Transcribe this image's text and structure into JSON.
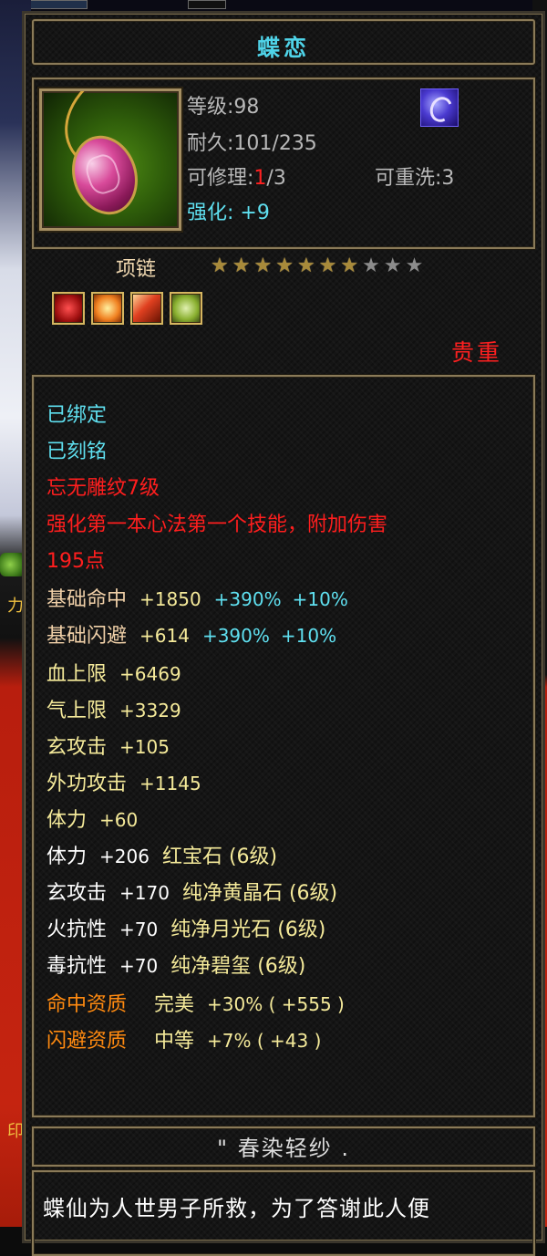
{
  "item": {
    "name": "蝶恋",
    "level_line": "等级:98",
    "durability_line": "耐久:101/235",
    "repair_prefix": "可修理:",
    "repair_used": "1",
    "repair_total": "/3",
    "rewash_line": "可重洗:3",
    "enhance_line": "强化: +9",
    "type": "项链",
    "stars_filled": 7,
    "stars_total": 10,
    "rarity": "贵重"
  },
  "attributes": {
    "bound": "已绑定",
    "engraved": "已刻铭",
    "carving": "忘无雕纹7级",
    "skill_line1": "强化第一本心法第一个技能，附加伤害",
    "skill_line2": "195点",
    "base_stats": [
      {
        "label": "基础命中",
        "value": "+1850",
        "pct1": "+390%",
        "pct2": "+10%"
      },
      {
        "label": "基础闪避",
        "value": "+614",
        "pct1": "+390%",
        "pct2": "+10%"
      }
    ],
    "bonus_stats": [
      {
        "label": "血上限",
        "value": "+6469"
      },
      {
        "label": "气上限",
        "value": "+3329"
      },
      {
        "label": "玄攻击",
        "value": "+105"
      },
      {
        "label": "外功攻击",
        "value": "+1145"
      },
      {
        "label": "体力",
        "value": "+60"
      }
    ],
    "gem_stats": [
      {
        "label": "体力",
        "value": "+206",
        "gem": "红宝石 (6级)"
      },
      {
        "label": "玄攻击",
        "value": "+170",
        "gem": "纯净黄晶石 (6级)"
      },
      {
        "label": "火抗性",
        "value": "+70",
        "gem": "纯净月光石 (6级)"
      },
      {
        "label": "毒抗性",
        "value": "+70",
        "gem": "纯净碧玺 (6级)"
      }
    ],
    "quality_stats": [
      {
        "label": "命中资质",
        "grade": "完美",
        "value": "+30% ( +555 )"
      },
      {
        "label": "闪避资质",
        "grade": "中等",
        "value": "+7% ( +43 )"
      }
    ]
  },
  "flavor": {
    "title": "\" 春染轻纱 .",
    "text": "蝶仙为人世男子所救，为了答谢此人便"
  },
  "background": {
    "left_text_1": "力",
    "left_text_2": "印"
  },
  "colors": {
    "title_cyan": "#4fd3e8",
    "red": "#ff1e1e",
    "peach": "#f0d0a8",
    "orange": "#ff8a10",
    "yellow": "#f5ea9a",
    "frame_gold": "#8a7a58"
  }
}
